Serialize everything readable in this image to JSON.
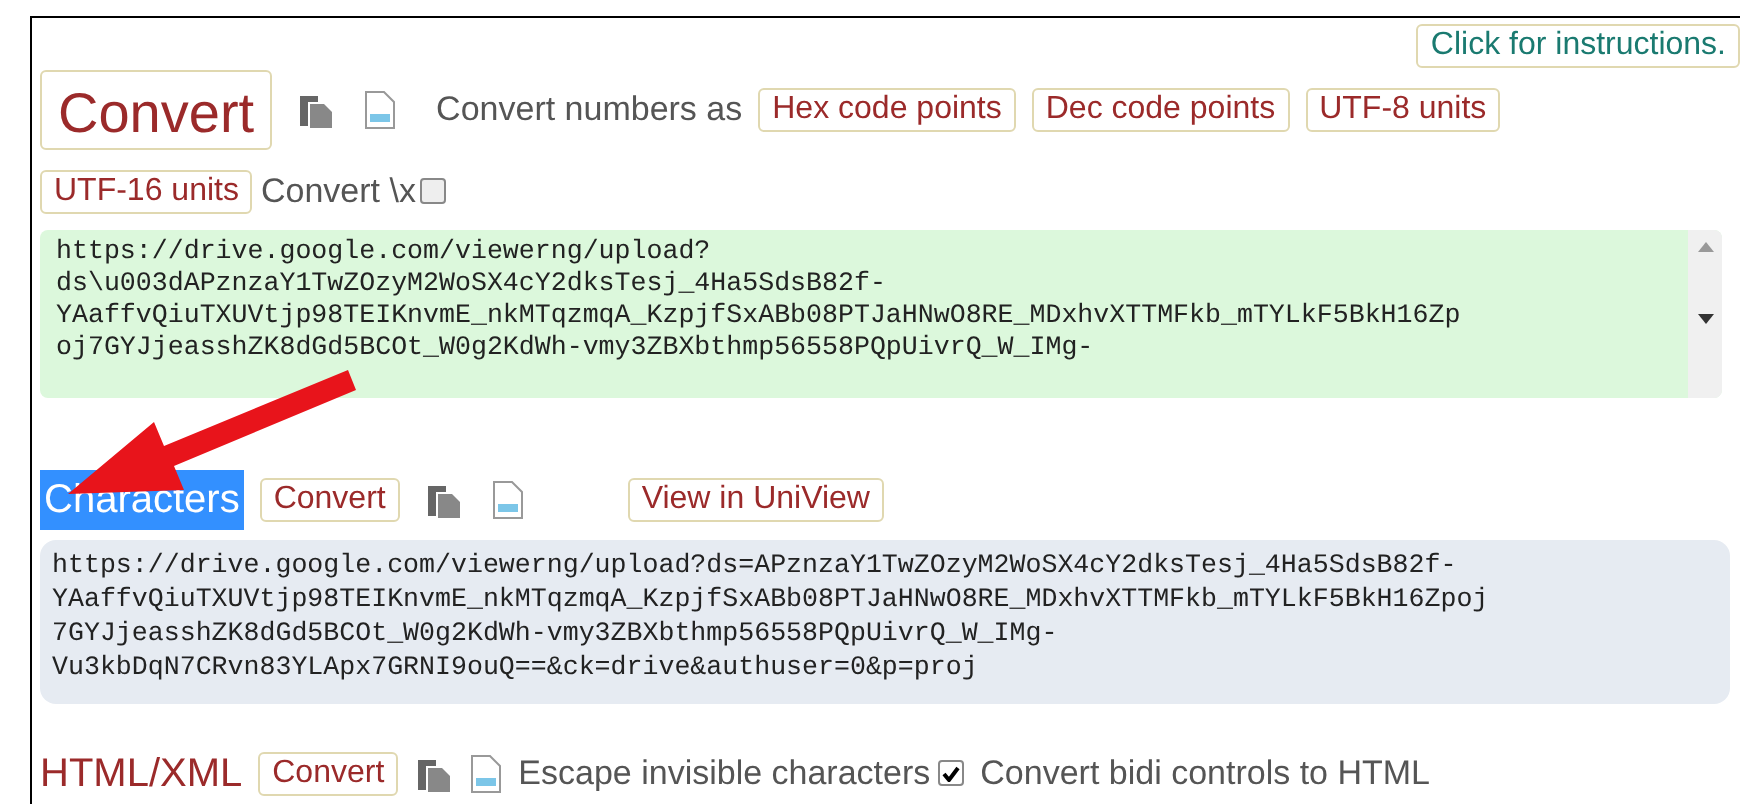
{
  "instructions_link": "Click for instructions.",
  "toolbar": {
    "convert": "Convert",
    "numbers_label": "Convert numbers as",
    "number_buttons": [
      "Hex code points",
      "Dec code points",
      "UTF-8 units",
      "UTF-16 units"
    ],
    "convert_x_label": "Convert \\x",
    "convert_x_checked": false
  },
  "input_box": {
    "lines": [
      "https://drive.google.com/viewerng/upload?",
      "ds\\u003dAPznzaY1TwZOzyM2WoSX4cY2dksTesj_4Ha5SdsB82f-",
      "YAaffvQiuTXUVtjp98TEIKnvmE_nkMTqzmqA_KzpjfSxABb08PTJaHNwO8RE_MDxhvXTTMFkb_mTYLkF5BkH16Zp",
      "oj7GYJjeasshZK8dGd5BCOt_W0g2KdWh-vmy3ZBXbthmp56558PQpUivrQ_W_IMg-"
    ]
  },
  "characters": {
    "title": "Characters",
    "title_selected": true,
    "convert": "Convert",
    "view": "View in UniView",
    "lines": [
      "https://drive.google.com/viewerng/upload?ds=APznzaY1TwZOzyM2WoSX4cY2dksTesj_4Ha5SdsB82f-",
      "YAaffvQiuTXUVtjp98TEIKnvmE_nkMTqzmqA_KzpjfSxABb08PTJaHNwO8RE_MDxhvXTTMFkb_mTYLkF5BkH16Zpoj",
      "7GYJjeasshZK8dGd5BCOt_W0g2KdWh-vmy3ZBXbthmp56558PQpUivrQ_W_IMg-",
      "Vu3kbDqN7CRvn83YLApx7GRNI9ouQ==&ck=drive&authuser=0&p=proj"
    ]
  },
  "html": {
    "title": "HTML/XML",
    "convert": "Convert",
    "escape_label": "Escape invisible characters",
    "escape_checked": true,
    "bidi_label": "Convert bidi controls to HTML"
  }
}
